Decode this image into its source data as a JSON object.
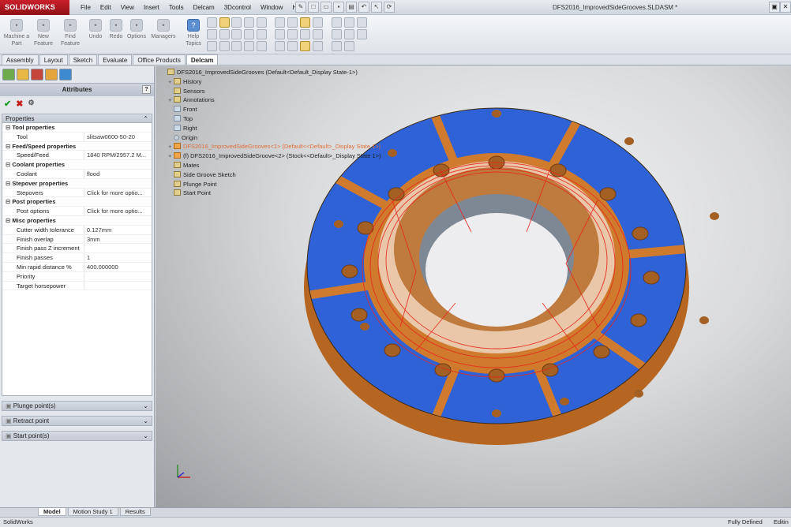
{
  "app": {
    "logo": "SOLIDWORKS",
    "doc_title": "DFS2016_ImprovedSideGrooves.SLDASM *",
    "menu": [
      "File",
      "Edit",
      "View",
      "Insert",
      "Tools",
      "Delcam",
      "3Dcontrol",
      "Window",
      "Help"
    ]
  },
  "ribbon": {
    "buttons": [
      {
        "label": "Machine a Part"
      },
      {
        "label": "New Feature"
      },
      {
        "label": "Find Feature"
      },
      {
        "label": "Undo"
      },
      {
        "label": "Redo"
      },
      {
        "label": "Options"
      },
      {
        "label": "Managers"
      },
      {
        "label": "Help Topics"
      }
    ]
  },
  "tabs": [
    "Assembly",
    "Layout",
    "Sketch",
    "Evaluate",
    "Office Products",
    "Delcam"
  ],
  "active_tab": "Delcam",
  "panel": {
    "header": "Attributes",
    "help": "?",
    "properties_label": "Properties",
    "rows": [
      {
        "type": "cat",
        "label": "Tool properties"
      },
      {
        "label": "Tool",
        "value": "slitsaw0600-50-20"
      },
      {
        "type": "cat",
        "label": "Feed/Speed properties"
      },
      {
        "label": "Speed/Feed",
        "value": "1840 RPM/2957.2 M..."
      },
      {
        "type": "cat",
        "label": "Coolant properties"
      },
      {
        "label": "Coolant",
        "value": "flood"
      },
      {
        "type": "cat",
        "label": "Stepover properties"
      },
      {
        "label": "Stepovers",
        "value": "Click for more optio..."
      },
      {
        "type": "cat",
        "label": "Post properties"
      },
      {
        "label": "Post options",
        "value": "Click for more optio..."
      },
      {
        "type": "cat",
        "label": "Misc properties"
      },
      {
        "label": "Cutter width tolerance",
        "value": "0.127mm"
      },
      {
        "label": "Finish overlap",
        "value": "3mm"
      },
      {
        "label": "Finish pass Z increment",
        "value": ""
      },
      {
        "label": "Finish passes",
        "value": "1"
      },
      {
        "label": "Min rapid distance %",
        "value": "400.000000"
      },
      {
        "label": "Priority",
        "value": ""
      },
      {
        "label": "Target horsepower",
        "value": ""
      }
    ],
    "sections": [
      "Plunge point(s)",
      "Retract point",
      "Start point(s)"
    ]
  },
  "tree": [
    {
      "label": "DFS2016_ImprovedSideGrooves  (Default<Default_Display State-1>)",
      "indent": 0,
      "icon": "assembly"
    },
    {
      "label": "History",
      "indent": 1,
      "icon": "folder",
      "pm": "+"
    },
    {
      "label": "Sensors",
      "indent": 1,
      "icon": "folder"
    },
    {
      "label": "Annotations",
      "indent": 1,
      "icon": "folder",
      "pm": "+"
    },
    {
      "label": "Front",
      "indent": 1,
      "icon": "plane"
    },
    {
      "label": "Top",
      "indent": 1,
      "icon": "plane"
    },
    {
      "label": "Right",
      "indent": 1,
      "icon": "plane"
    },
    {
      "label": "Origin",
      "indent": 1,
      "icon": "point"
    },
    {
      "label": "DFS2016_ImprovedSideGrooves<1> (Default<<Default>_Display State 1>)",
      "indent": 1,
      "icon": "part",
      "pm": "+",
      "selected": true
    },
    {
      "label": "(f)  DFS2016_ImprovedSideGroove<2> (Stock<<Default>_Display State 1>)",
      "indent": 1,
      "icon": "part",
      "pm": "+"
    },
    {
      "label": "Mates",
      "indent": 1,
      "icon": "folder"
    },
    {
      "label": "Side Groove Sketch",
      "indent": 1,
      "icon": "sketch"
    },
    {
      "label": "Plunge Point",
      "indent": 1,
      "icon": "sketch"
    },
    {
      "label": "Start Point",
      "indent": 1,
      "icon": "sketch"
    }
  ],
  "bottom_tabs": [
    "Model",
    "Motion Study 1",
    "Results"
  ],
  "status": {
    "left": "SolidWorks",
    "right1": "Fully Defined",
    "right2": "Editin"
  },
  "colors": {
    "part_face": "#2f62d6",
    "part_side": "#cf7a2c",
    "toolpath": "#e8261c",
    "logo_bg": "#b81a22"
  }
}
